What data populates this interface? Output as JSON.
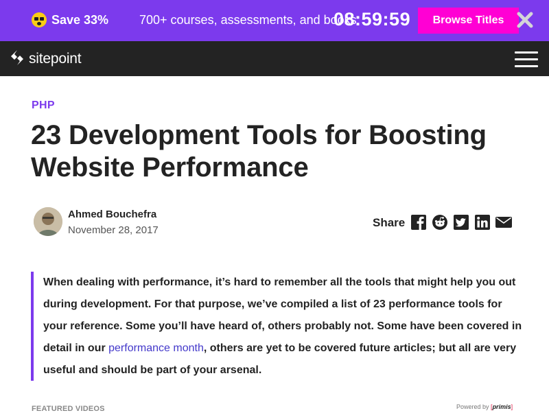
{
  "promo": {
    "save": "Save 33%",
    "text": "700+ courses, assessments, and books",
    "timer": "08:59:59",
    "button": "Browse Titles"
  },
  "nav": {
    "logo_text": "sitepoint"
  },
  "article": {
    "category": "PHP",
    "title": "23 Development Tools for Boosting Website Performance",
    "author": "Ahmed Bouchefra",
    "date": "November 28, 2017",
    "share_label": "Share",
    "share_icons": [
      "facebook-icon",
      "reddit-icon",
      "twitter-icon",
      "linkedin-icon",
      "email-icon"
    ],
    "intro_before": "When dealing with performance, it’s hard to remember all the tools that might help you out during development. For that purpose, we’ve compiled a list of 23 performance tools for your reference. Some you’ll have heard of, others probably not. Some have been covered in detail in our ",
    "intro_link": "performance month",
    "intro_after": ", others are yet to be covered future articles; but all are very useful and should be part of your arsenal."
  },
  "footer": {
    "featured": "FEATURED VIDEOS",
    "powered_by": "Powered by",
    "powered_brand": "primis"
  },
  "colors": {
    "accent": "#7c3aed",
    "cta": "#ff00d4",
    "nav_bg": "#232323",
    "link": "#4338ca"
  }
}
